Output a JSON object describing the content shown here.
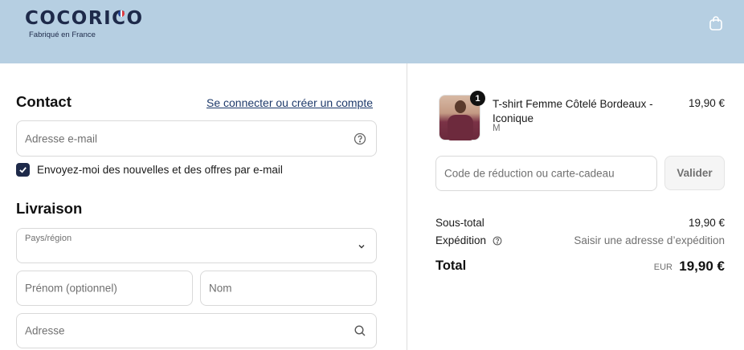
{
  "header": {
    "logo_text": "COCORICO",
    "logo_subtitle": "Fabriqué en France",
    "bg_color": "#b6cfe2",
    "cart_icon": "shopping-bag-icon"
  },
  "contact": {
    "title": "Contact",
    "login_link": "Se connecter ou créer un compte",
    "email_placeholder": "Adresse e-mail",
    "newsletter_label": "Envoyez-moi des nouvelles et des offres par e-mail",
    "newsletter_checked": true
  },
  "delivery": {
    "title": "Livraison",
    "country_label": "Pays/région",
    "country_value": "",
    "firstname_placeholder": "Prénom (optionnel)",
    "lastname_placeholder": "Nom",
    "address_placeholder": "Adresse"
  },
  "order": {
    "item": {
      "name": "T-shirt Femme Côtelé Bordeaux - Iconique",
      "variant": "M",
      "quantity": "1",
      "price": "19,90 €"
    },
    "discount_placeholder": "Code de réduction ou carte-cadeau",
    "discount_button": "Valider",
    "subtotal_label": "Sous-total",
    "subtotal_value": "19,90 €",
    "shipping_label": "Expédition",
    "shipping_value": "Saisir une adresse d’expédition",
    "total_label": "Total",
    "total_currency": "EUR",
    "total_value": "19,90 €"
  },
  "colors": {
    "accent": "#1e2a4a",
    "link": "#1e3a6b"
  }
}
